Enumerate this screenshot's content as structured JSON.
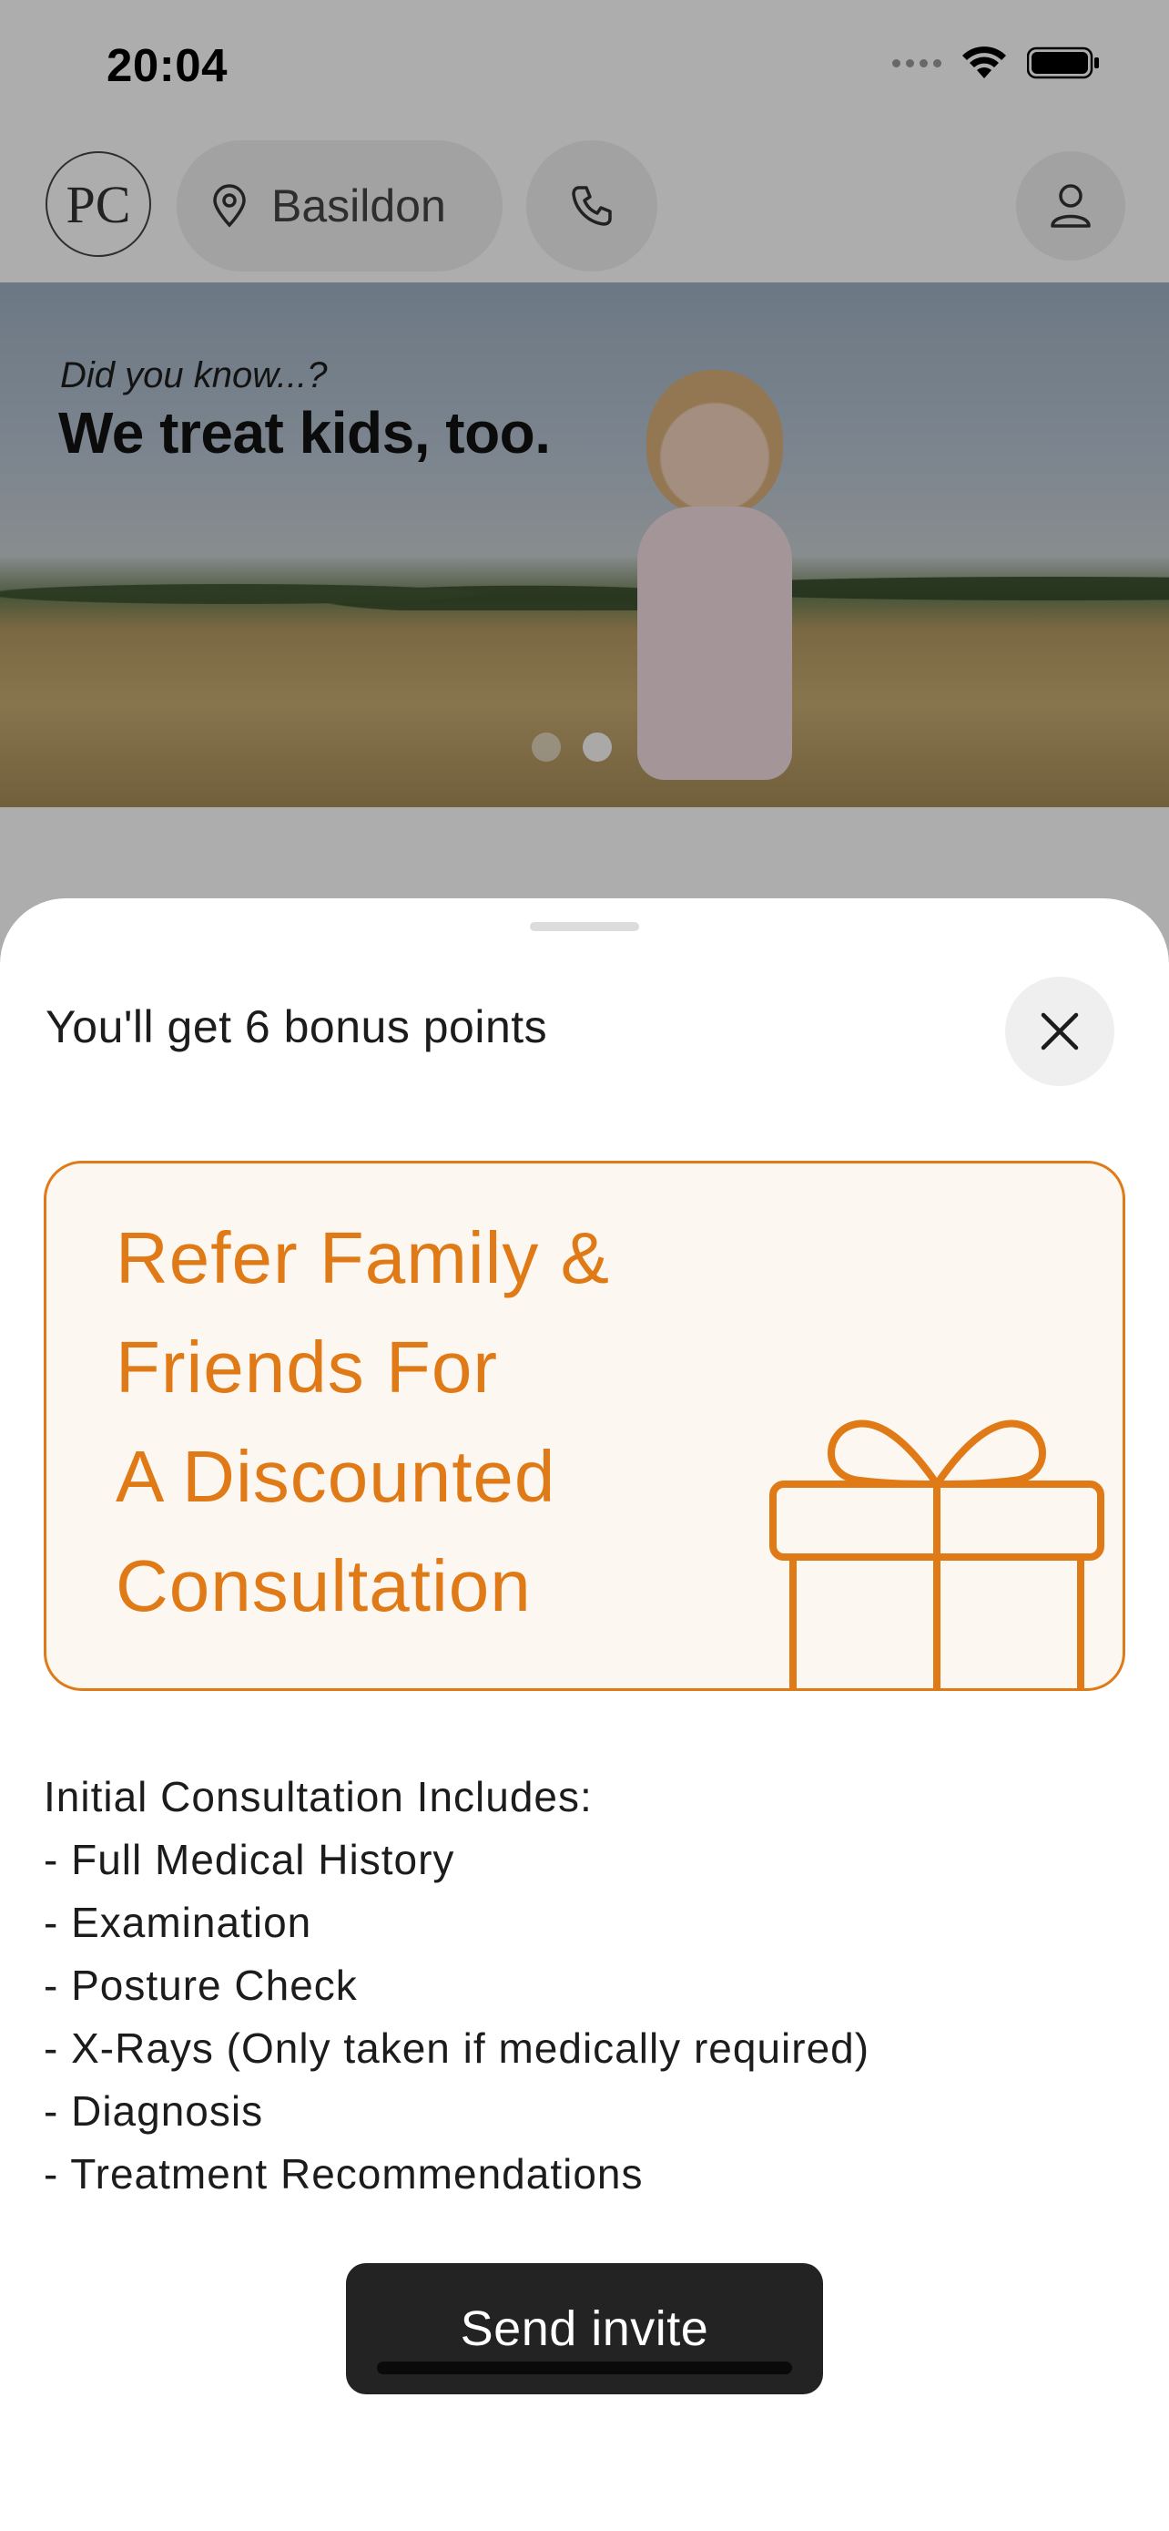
{
  "status_bar": {
    "time": "20:04"
  },
  "header": {
    "logo_text": "PC",
    "location": "Basildon"
  },
  "hero": {
    "subtitle": "Did you know...?",
    "headline": "We treat kids, too."
  },
  "sheet": {
    "title": "You'll get 6 bonus points",
    "promo_lines": [
      "Refer Family &",
      "Friends For",
      "A Discounted",
      "Consultation"
    ],
    "includes": [
      "Initial Consultation Includes:",
      "- Full Medical History",
      "- Examination",
      "- Posture Check",
      "- X-Rays (Only taken if medically required)",
      "- Diagnosis",
      "- Treatment Recommendations"
    ],
    "button_label": "Send invite"
  },
  "colors": {
    "accent": "#e07a16",
    "button": "#232323",
    "overlay": "rgba(0,0,0,0.32)"
  },
  "icons": [
    "location-pin-icon",
    "phone-icon",
    "user-icon",
    "close-icon",
    "gift-icon",
    "wifi-icon",
    "battery-icon"
  ]
}
